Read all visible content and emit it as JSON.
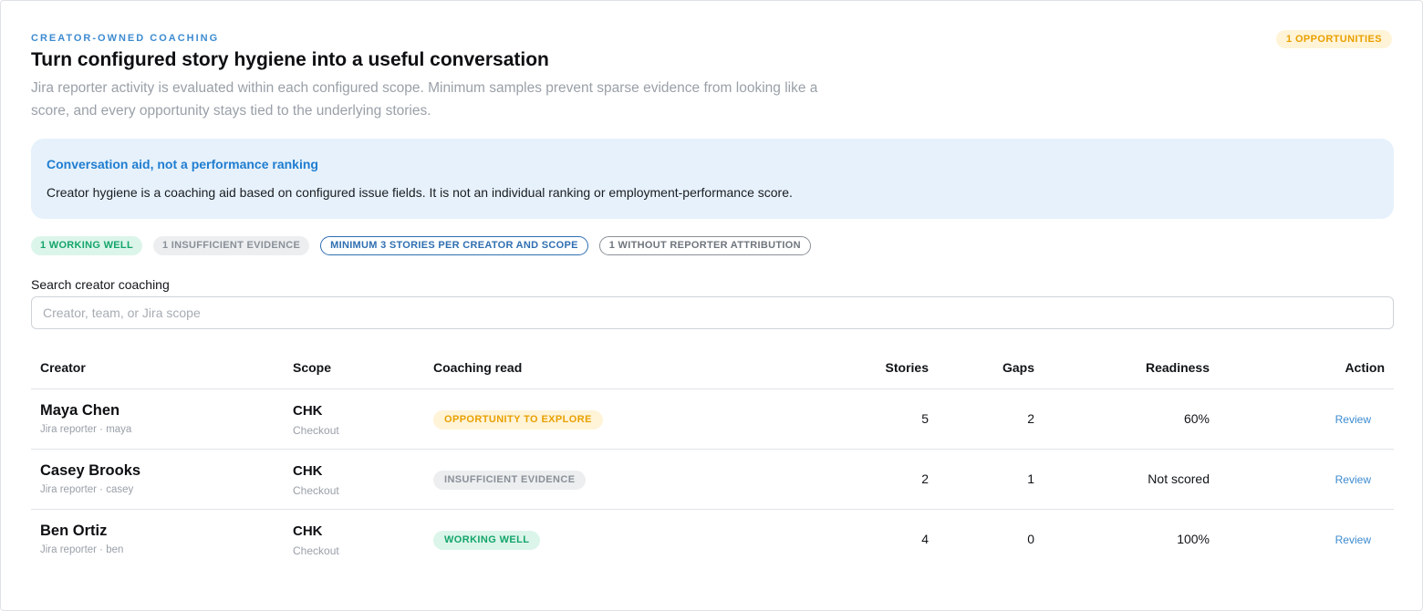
{
  "header": {
    "eyebrow": "CREATOR-OWNED COACHING",
    "title": "Turn configured story hygiene into a useful conversation",
    "subtitle": "Jira reporter activity is evaluated within each configured scope. Minimum samples prevent sparse evidence from looking like a score, and every opportunity stays tied to the underlying stories.",
    "opportunities_badge": "1 OPPORTUNITIES"
  },
  "notice": {
    "title": "Conversation aid, not a performance ranking",
    "body": "Creator hygiene is a coaching aid based on configured issue fields. It is not an individual ranking or employment-performance score."
  },
  "chips": {
    "working_well": "1 WORKING WELL",
    "insufficient": "1 INSUFFICIENT EVIDENCE",
    "minimum": "MINIMUM 3 STORIES PER CREATOR AND SCOPE",
    "without_attribution": "1 WITHOUT REPORTER ATTRIBUTION"
  },
  "search": {
    "label": "Search creator coaching",
    "placeholder": "Creator, team, or Jira scope",
    "value": ""
  },
  "table": {
    "headers": {
      "creator": "Creator",
      "scope": "Scope",
      "coaching": "Coaching read",
      "stories": "Stories",
      "gaps": "Gaps",
      "readiness": "Readiness",
      "action": "Action"
    },
    "rows": [
      {
        "name": "Maya Chen",
        "sub": "Jira reporter · maya",
        "scope": "CHK",
        "scope_sub": "Checkout",
        "status": "OPPORTUNITY TO EXPLORE",
        "status_color": "#e9a000",
        "stories": "5",
        "gaps": "2",
        "readiness": "60%",
        "action": "Review"
      },
      {
        "name": "Casey Brooks",
        "sub": "Jira reporter · casey",
        "scope": "CHK",
        "scope_sub": "Checkout",
        "status": "INSUFFICIENT EVIDENCE",
        "status_color": "#8a9098",
        "stories": "2",
        "gaps": "1",
        "readiness": "Not scored",
        "action": "Review"
      },
      {
        "name": "Ben Ortiz",
        "sub": "Jira reporter · ben",
        "scope": "CHK",
        "scope_sub": "Checkout",
        "status": "WORKING WELL",
        "status_color": "#13a56a",
        "stories": "4",
        "gaps": "0",
        "readiness": "100%",
        "action": "Review"
      }
    ]
  },
  "colors": {
    "accent": "#3d8bd0",
    "notice_bg": "#e6f1fb",
    "warning": "#e9a000",
    "success": "#13a56a"
  }
}
